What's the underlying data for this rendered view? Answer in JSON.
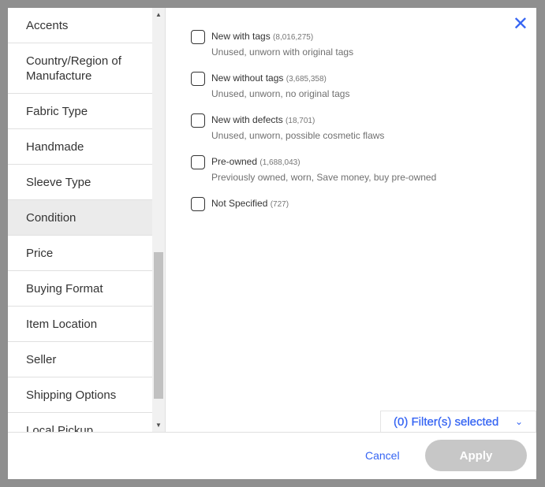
{
  "sidebar": {
    "items": [
      {
        "label": "Accents"
      },
      {
        "label": "Country/Region of Manufacture"
      },
      {
        "label": "Fabric Type"
      },
      {
        "label": "Handmade"
      },
      {
        "label": "Sleeve Type"
      },
      {
        "label": "Condition",
        "selected": true
      },
      {
        "label": "Price"
      },
      {
        "label": "Buying Format"
      },
      {
        "label": "Item Location"
      },
      {
        "label": "Seller"
      },
      {
        "label": "Shipping Options"
      },
      {
        "label": "Local Pickup"
      }
    ]
  },
  "options": [
    {
      "label": "New with tags",
      "count": "(8,016,275)",
      "desc": "Unused, unworn with original tags",
      "checked": false
    },
    {
      "label": "New without tags",
      "count": "(3,685,358)",
      "desc": "Unused, unworn, no original tags",
      "checked": false
    },
    {
      "label": "New with defects",
      "count": "(18,701)",
      "desc": "Unused, unworn, possible cosmetic flaws",
      "checked": false
    },
    {
      "label": "Pre-owned",
      "count": "(1,688,043)",
      "desc": "Previously owned, worn, Save money, buy pre-owned",
      "checked": false
    },
    {
      "label": "Not Specified",
      "count": "(727)",
      "desc": "",
      "checked": false
    }
  ],
  "filters_selected": "(0) Filter(s) selected",
  "footer": {
    "cancel": "Cancel",
    "apply": "Apply"
  },
  "colors": {
    "accent": "#3665f3",
    "apply_disabled": "#c7c7c7"
  }
}
